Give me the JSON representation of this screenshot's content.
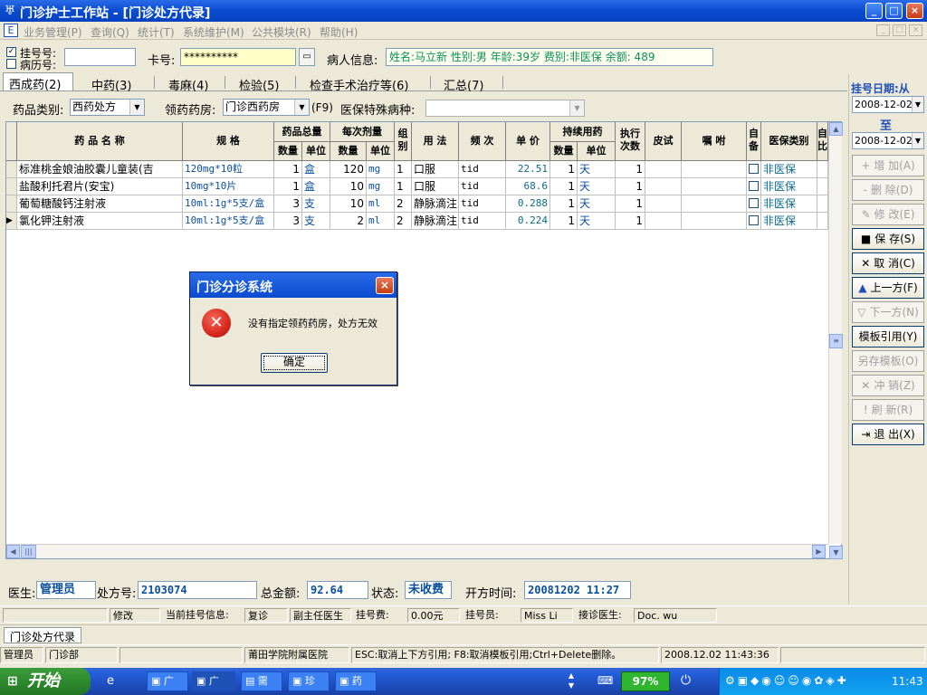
{
  "window": {
    "title": "门诊护士工作站 - [门诊处方代录]",
    "min": "_",
    "max": "□",
    "close": "×"
  },
  "menu": {
    "items": [
      "业务管理(P)",
      "查询(Q)",
      "统计(T)",
      "系统维护(M)",
      "公共模块(R)",
      "帮助(H)"
    ],
    "mdi": [
      "_",
      "□",
      "×"
    ]
  },
  "reg": {
    "chk_reg_label": "挂号号:",
    "chk_rec_label": "病历号:",
    "card_label": "卡号:",
    "card_value": "**********",
    "patient_label": "病人信息:",
    "patient_value": "姓名:马立新 性别:男 年龄:39岁 费别:非医保 余额: 489"
  },
  "tabs": [
    "西成药(2)",
    "中药(3)",
    "毒麻(4)",
    "检验(5)",
    "检查手术治疗等(6)",
    "汇总(7)"
  ],
  "filters": {
    "drug_type_label": "药品类别:",
    "drug_type_value": "西药处方",
    "pharmacy_label": "领药药房:",
    "pharmacy_value": "门诊西药房",
    "pharmacy_key": "(F9)",
    "special_label": "医保特殊病种:",
    "special_value": ""
  },
  "grid": {
    "headers": {
      "name": "药 品 名 称",
      "spec": "规    格",
      "total": "药品总量",
      "total_qty": "数量",
      "total_unit": "单位",
      "dose": "每次剂量",
      "dose_qty": "数量",
      "dose_unit": "单位",
      "group": "组别",
      "usage": "用 法",
      "freq": "频 次",
      "price": "单 价",
      "cont": "持续用药",
      "cont_qty": "数量",
      "cont_unit": "单位",
      "exec": "执行次数",
      "skin": "皮试",
      "note": "嘱 咐",
      "self": "自备",
      "ins": "医保类别",
      "last": "自比"
    },
    "rows": [
      {
        "name": "标准桃金娘油胶囊儿童装(吉",
        "spec": "120mg*10粒",
        "qty": "1",
        "unit": "盒",
        "dose": "120",
        "dose_unit": "mg",
        "group": "1",
        "usage": "口服",
        "freq": "tid",
        "price": "22.51",
        "days": "1",
        "days_unit": "天",
        "exec": "1",
        "ins": "非医保"
      },
      {
        "name": "盐酸利托君片(安宝)",
        "spec": "10mg*10片",
        "qty": "1",
        "unit": "盒",
        "dose": "10",
        "dose_unit": "mg",
        "group": "1",
        "usage": "口服",
        "freq": "tid",
        "price": "68.6",
        "days": "1",
        "days_unit": "天",
        "exec": "1",
        "ins": "非医保"
      },
      {
        "name": "葡萄糖酸钙注射液",
        "spec": "10ml:1g*5支/盒",
        "qty": "3",
        "unit": "支",
        "dose": "10",
        "dose_unit": "ml",
        "group": "2",
        "usage": "静脉滴注",
        "freq": "tid",
        "price": "0.288",
        "days": "1",
        "days_unit": "天",
        "exec": "1",
        "ins": "非医保"
      },
      {
        "name": "氯化钾注射液",
        "spec": "10ml:1g*5支/盒",
        "qty": "3",
        "unit": "支",
        "dose": "2",
        "dose_unit": "ml",
        "group": "2",
        "usage": "静脉滴注",
        "freq": "tid",
        "price": "0.224",
        "days": "1",
        "days_unit": "天",
        "exec": "1",
        "ins": "非医保"
      }
    ],
    "row_marker": "▶"
  },
  "footer": {
    "doctor_label": "医生:",
    "doctor_value": "管理员",
    "rx_label": "处方号:",
    "rx_value": "2103074",
    "total_label": "总金额:",
    "total_value": "92.64",
    "state_label": "状态:",
    "state_value": "未收费",
    "time_label": "开方时间:",
    "time_value": "20081202 11:27"
  },
  "regbar": {
    "modify": "修改",
    "cur_label": "当前挂号信息:",
    "visit": "复诊",
    "title": "副主任医生",
    "fee_label": "挂号费:",
    "fee": "0.00元",
    "clerk_label": "挂号员:",
    "clerk": "Miss Li",
    "doc_label": "接诊医生:",
    "doc": "Doc. wu"
  },
  "mdi_tab": "门诊处方代录",
  "status": {
    "user": "管理员",
    "dept": "门诊部",
    "hospital": "莆田学院附属医院",
    "hint": "ESC:取消上下方引用; F8:取消模板引用;Ctrl+Delete删除。",
    "datetime": "2008.12.02 11:43:36"
  },
  "right": {
    "date_label": "挂号日期:从",
    "date_from": "2008-12-02",
    "to_label": "至",
    "date_to": "2008-12-02",
    "buttons": [
      {
        "label": "增  加(A)",
        "icon": "+",
        "enabled": false
      },
      {
        "label": "删  除(D)",
        "icon": "-",
        "enabled": false
      },
      {
        "label": "修  改(E)",
        "icon": "✎",
        "enabled": false
      },
      {
        "label": "保  存(S)",
        "icon": "■",
        "enabled": true
      },
      {
        "label": "取  消(C)",
        "icon": "✕",
        "enabled": true
      },
      {
        "label": "上一方(F)",
        "icon": "▲",
        "enabled": true
      },
      {
        "label": "下一方(N)",
        "icon": "▽",
        "enabled": false
      },
      {
        "label": "模板引用(Y)",
        "icon": "",
        "enabled": true
      },
      {
        "label": "另存模板(O)",
        "icon": "",
        "enabled": false
      },
      {
        "label": "冲  销(Z)",
        "icon": "✕",
        "enabled": false
      },
      {
        "label": "刷  新(R)",
        "icon": "!",
        "enabled": false
      },
      {
        "label": "退  出(X)",
        "icon": "⇥",
        "enabled": true
      }
    ]
  },
  "dialog": {
    "title": "门诊分诊系统",
    "message": "没有指定领药药房，处方无效",
    "ok": "确定",
    "close": "×",
    "icon": "✕"
  },
  "taskbar": {
    "start": "开始",
    "items": [
      "广",
      "广",
      "需",
      "珍",
      "药"
    ],
    "battery": "97%",
    "clock": "11:43"
  },
  "colors": {
    "title_blue": "#0a4bd0",
    "text_blue": "#0a4f9c",
    "patient_green": "#0b8f5a",
    "error_red": "#d8271d"
  }
}
